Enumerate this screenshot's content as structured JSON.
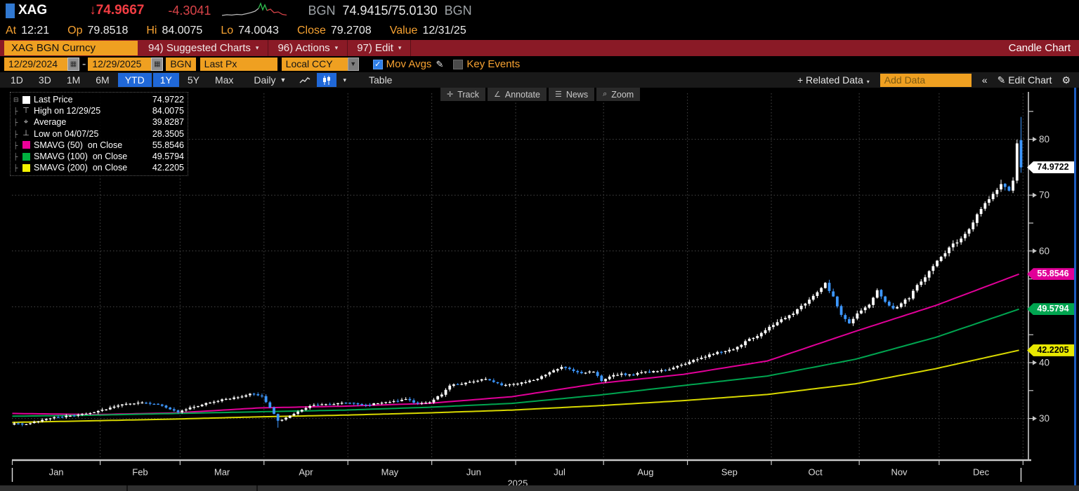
{
  "quote_bar": {
    "ticker": "XAG",
    "arrow": "↓",
    "last": "74.9667",
    "change": "-4.3041",
    "source_left": "BGN",
    "bid_ask": "74.9415/75.0130",
    "source_right": "BGN",
    "sparkline": {
      "segments": [
        {
          "color": "#b9b9b9",
          "points": [
            [
              0,
              19
            ],
            [
              7,
              18
            ],
            [
              14,
              18.5
            ],
            [
              21,
              17.5
            ],
            [
              28,
              18
            ],
            [
              35,
              16.5
            ],
            [
              41,
              15
            ],
            [
              47,
              13
            ],
            [
              52,
              9
            ]
          ]
        },
        {
          "color": "#2fbf4f",
          "points": [
            [
              52,
              9
            ],
            [
              55,
              2
            ],
            [
              58,
              11
            ],
            [
              61,
              4
            ],
            [
              64,
              12
            ]
          ]
        },
        {
          "color": "#d84348",
          "points": [
            [
              64,
              12
            ],
            [
              69,
              10
            ],
            [
              74,
              15
            ],
            [
              80,
              14
            ],
            [
              86,
              17.5
            ],
            [
              92,
              18.5
            ]
          ]
        }
      ]
    }
  },
  "stats": [
    {
      "label": "At",
      "value": "12:21"
    },
    {
      "label": "Op",
      "value": "79.8518"
    },
    {
      "label": "Hi",
      "value": "84.0075"
    },
    {
      "label": "Lo",
      "value": "74.0043"
    },
    {
      "label": "Close",
      "value": "79.2708"
    },
    {
      "label": "Value",
      "value": "12/31/25"
    }
  ],
  "menu_bar": {
    "security": "XAG BGN Curncy",
    "items": [
      {
        "num": "94)",
        "label": "Suggested Charts",
        "caret": "▾"
      },
      {
        "num": "96)",
        "label": "Actions",
        "caret": "▾"
      },
      {
        "num": "97)",
        "label": "Edit",
        "caret": "▾"
      }
    ],
    "right_label": "Candle Chart"
  },
  "controls_bar": {
    "date_from": "12/29/2024",
    "date_separator": "-",
    "date_to": "12/29/2025",
    "source": "BGN",
    "field": "Last Px",
    "currency": "Local CCY",
    "mov_avgs_label": "Mov Avgs",
    "mov_avgs_checked": true,
    "key_events_label": "Key Events",
    "key_events_checked": false
  },
  "toolbar": {
    "periods": [
      {
        "label": "1D",
        "active": false
      },
      {
        "label": "3D",
        "active": false
      },
      {
        "label": "1M",
        "active": false
      },
      {
        "label": "6M",
        "active": false
      },
      {
        "label": "YTD",
        "active": true
      },
      {
        "label": "1Y",
        "active": true
      },
      {
        "label": "5Y",
        "active": false
      },
      {
        "label": "Max",
        "active": false
      }
    ],
    "frequency": "Daily",
    "table_label": "Table",
    "related_data_label": "+ Related Data",
    "add_data_placeholder": "Add Data",
    "collapse_label": "«",
    "edit_chart_label": "Edit Chart"
  },
  "chart": {
    "overlay_buttons": [
      {
        "icon": "track",
        "glyph": "✛",
        "label": "Track"
      },
      {
        "icon": "annotate",
        "glyph": "∠",
        "label": "Annotate"
      },
      {
        "icon": "news",
        "glyph": "☰",
        "label": "News"
      },
      {
        "icon": "zoom",
        "glyph": "⌕",
        "label": "Zoom"
      }
    ],
    "legend_rows": [
      {
        "marker": "square",
        "color": "#ffffff",
        "label": "Last Price",
        "value": "74.9722"
      },
      {
        "marker": "high",
        "label": "High on 12/29/25",
        "value": "84.0075"
      },
      {
        "marker": "avg",
        "label": "Average",
        "value": "39.8287"
      },
      {
        "marker": "low",
        "label": "Low on 04/07/25",
        "value": "28.3505"
      },
      {
        "marker": "square",
        "color": "#ec0099",
        "label": "SMAVG (50)  on Close",
        "value": "55.8546"
      },
      {
        "marker": "square",
        "color": "#00b140",
        "label": "SMAVG (100)  on Close",
        "value": "49.5794"
      },
      {
        "marker": "square",
        "color": "#f2f200",
        "label": "SMAVG (200)  on Close",
        "value": "42.2205"
      }
    ],
    "badges": [
      {
        "value": "74.9722",
        "bg": "#ffffff",
        "fg": "#000000",
        "price": 74.9722
      },
      {
        "value": "55.8546",
        "bg": "#e10098",
        "fg": "#ffffff",
        "price": 55.8546
      },
      {
        "value": "49.5794",
        "bg": "#00a550",
        "fg": "#ffffff",
        "price": 49.5794
      },
      {
        "value": "42.2205",
        "bg": "#e8e800",
        "fg": "#000000",
        "price": 42.2205
      }
    ],
    "y_axis_labels": [
      30,
      40,
      60,
      70,
      80
    ],
    "y_axis_minor_ticks": [
      35,
      45,
      55,
      65,
      75,
      85
    ],
    "year_label": "2025"
  },
  "chart_data": {
    "type": "candlestick",
    "symbol": "XAG BGN Curncy",
    "period": "12/29/2024 - 12/29/2025",
    "frequency": "Daily",
    "ylim": [
      19.5,
      88
    ],
    "grid_prices": [
      30,
      40,
      50,
      60,
      70,
      80
    ],
    "months": [
      "Jan",
      "Feb",
      "Mar",
      "Apr",
      "May",
      "Jun",
      "Jul",
      "Aug",
      "Sep",
      "Oct",
      "Nov",
      "Dec"
    ],
    "month_start_days": [
      0,
      22,
      42,
      63,
      84,
      105,
      126,
      148,
      169,
      190,
      212,
      232,
      253
    ],
    "first_open": 28.9,
    "close_anchors": [
      [
        0,
        29.1
      ],
      [
        3,
        28.9
      ],
      [
        8,
        30.0
      ],
      [
        13,
        30.4
      ],
      [
        18,
        30.8
      ],
      [
        21,
        31.3
      ],
      [
        26,
        32.3
      ],
      [
        31,
        32.9
      ],
      [
        36,
        32.4
      ],
      [
        41,
        31.2
      ],
      [
        46,
        32.3
      ],
      [
        51,
        33.2
      ],
      [
        56,
        33.8
      ],
      [
        59,
        34.4
      ],
      [
        62,
        33.9
      ],
      [
        64,
        31.9
      ],
      [
        66,
        29.6
      ],
      [
        69,
        30.4
      ],
      [
        74,
        32.3
      ],
      [
        79,
        32.6
      ],
      [
        83,
        32.9
      ],
      [
        88,
        32.4
      ],
      [
        93,
        32.9
      ],
      [
        98,
        33.4
      ],
      [
        101,
        32.7
      ],
      [
        104,
        33.0
      ],
      [
        107,
        34.3
      ],
      [
        109,
        35.9
      ],
      [
        114,
        36.5
      ],
      [
        118,
        37.1
      ],
      [
        122,
        35.9
      ],
      [
        125,
        36.1
      ],
      [
        130,
        36.9
      ],
      [
        135,
        38.5
      ],
      [
        137,
        39.2
      ],
      [
        142,
        38.1
      ],
      [
        145,
        38.4
      ],
      [
        147,
        36.8
      ],
      [
        150,
        37.9
      ],
      [
        155,
        37.9
      ],
      [
        159,
        38.4
      ],
      [
        164,
        38.8
      ],
      [
        168,
        39.8
      ],
      [
        172,
        40.9
      ],
      [
        176,
        41.8
      ],
      [
        180,
        42.3
      ],
      [
        184,
        44.2
      ],
      [
        187,
        45.2
      ],
      [
        189,
        46.3
      ],
      [
        192,
        47.6
      ],
      [
        196,
        49.4
      ],
      [
        199,
        51.4
      ],
      [
        201,
        52.6
      ],
      [
        203,
        54.1
      ],
      [
        205,
        51.8
      ],
      [
        207,
        48.6
      ],
      [
        209,
        47.2
      ],
      [
        211,
        48.7
      ],
      [
        214,
        50.3
      ],
      [
        216,
        52.9
      ],
      [
        218,
        50.8
      ],
      [
        220,
        49.6
      ],
      [
        222,
        50.6
      ],
      [
        224,
        51.7
      ],
      [
        226,
        53.8
      ],
      [
        228,
        55.4
      ],
      [
        230,
        57.1
      ],
      [
        231,
        58.2
      ],
      [
        233,
        59.6
      ],
      [
        235,
        61.3
      ],
      [
        237,
        62.1
      ],
      [
        239,
        64.1
      ],
      [
        241,
        66.4
      ],
      [
        243,
        68.5
      ],
      [
        245,
        70.3
      ],
      [
        247,
        71.9
      ],
      [
        249,
        70.8
      ],
      [
        250,
        72.6
      ],
      [
        251,
        79.2708
      ],
      [
        252,
        74.9722
      ]
    ],
    "overrides": {
      "66": {
        "low": 28.3505,
        "close": 29.6
      },
      "251": {
        "open": 72.6,
        "close": 79.2708,
        "high": 79.95,
        "low": 72.1
      },
      "252": {
        "open": 79.8518,
        "high": 84.0075,
        "low": 74.0043,
        "close": 74.9722
      }
    },
    "last_candle": {
      "open": 79.8518,
      "high": 84.0075,
      "low": 74.0043,
      "close": 74.9722
    },
    "stats": {
      "last": 74.9722,
      "high": {
        "date": "12/29/25",
        "value": 84.0075
      },
      "average": 39.8287,
      "low": {
        "date": "04/07/25",
        "value": 28.3505
      }
    },
    "moving_averages": [
      {
        "name": "SMAVG (50) on Close",
        "color": "#e10098",
        "days": [
          0,
          21,
          41,
          62,
          83,
          104,
          125,
          147,
          168,
          189,
          211,
          231,
          252
        ],
        "values": [
          30.9,
          30.7,
          31.0,
          31.9,
          32.2,
          32.7,
          33.9,
          36.3,
          37.9,
          40.3,
          45.6,
          50.2,
          55.8546
        ]
      },
      {
        "name": "SMAVG (100) on Close",
        "color": "#00a550",
        "days": [
          0,
          21,
          41,
          62,
          83,
          104,
          125,
          147,
          168,
          189,
          211,
          231,
          252
        ],
        "values": [
          30.4,
          30.6,
          30.9,
          31.2,
          31.5,
          32.0,
          32.7,
          34.2,
          35.9,
          37.6,
          40.6,
          44.5,
          49.5794
        ]
      },
      {
        "name": "SMAVG (200) on Close",
        "color": "#d8d800",
        "days": [
          0,
          21,
          41,
          62,
          83,
          104,
          125,
          147,
          168,
          189,
          211,
          231,
          252
        ],
        "values": [
          29.3,
          29.6,
          29.9,
          30.3,
          30.6,
          31.0,
          31.5,
          32.3,
          33.2,
          34.3,
          36.2,
          38.9,
          42.2205
        ]
      }
    ],
    "up_color": "#ffffff",
    "down_color": "#3d97ff",
    "grid_color": "#474747",
    "axis_color": "#c8c8c8"
  }
}
